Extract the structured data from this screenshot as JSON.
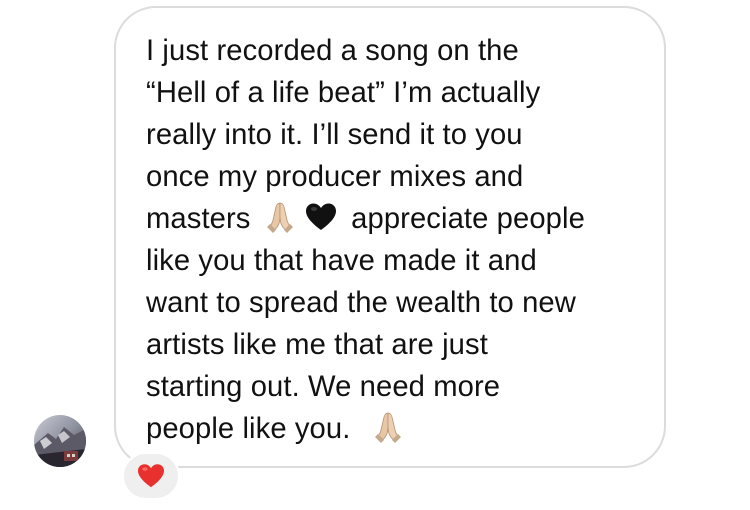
{
  "thread": {
    "message": {
      "lines": [
        "I just recorded a song on the",
        "“Hell of a life beat” I’m actually",
        "really into it. I’ll send it to you",
        "once my producer mixes and",
        "masters",
        "appreciate people",
        "like you that have made it and",
        "want to spread the wealth to new",
        "artists like me that are just",
        "starting out. We need more",
        "people like you."
      ],
      "emoji": [
        "folded-hands-icon",
        "black-heart-icon"
      ],
      "end_emoji": "folded-hands-icon"
    },
    "reaction": {
      "icon": "red-heart-icon",
      "color": "#e8302f"
    },
    "colors": {
      "bubble_border": "#dcdcdc",
      "reaction_bg": "#efefef",
      "text": "#111111"
    }
  }
}
